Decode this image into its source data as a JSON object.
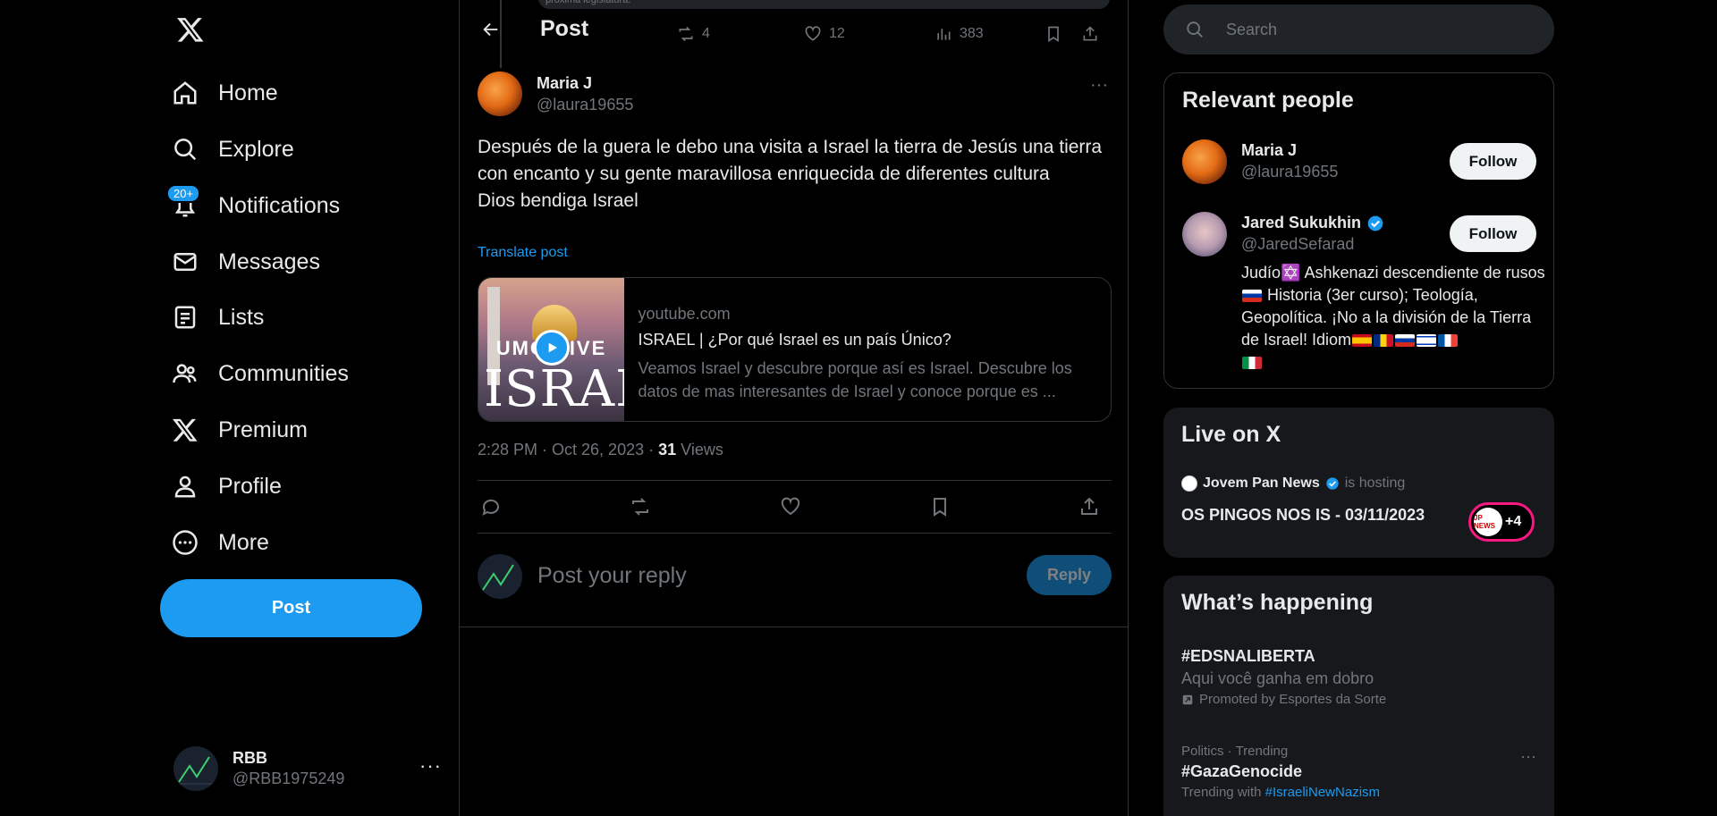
{
  "nav": {
    "items": [
      {
        "label": "Home",
        "icon": "home-icon"
      },
      {
        "label": "Explore",
        "icon": "search-icon"
      },
      {
        "label": "Notifications",
        "icon": "bell-icon"
      },
      {
        "label": "Messages",
        "icon": "mail-icon"
      },
      {
        "label": "Lists",
        "icon": "list-icon"
      },
      {
        "label": "Communities",
        "icon": "people-icon"
      },
      {
        "label": "Premium",
        "icon": "x-logo-icon"
      },
      {
        "label": "Profile",
        "icon": "person-icon"
      },
      {
        "label": "More",
        "icon": "more-circle-icon"
      }
    ],
    "notif_badge": "20+",
    "post_label": "Post",
    "account": {
      "name": "RBB",
      "handle": "@RBB1975249",
      "more": "···"
    }
  },
  "header": {
    "title": "Post"
  },
  "previous": {
    "strip_text": "próxima legislatura.",
    "retweets": "4",
    "likes": "12",
    "views": "383"
  },
  "post": {
    "author_name": "Maria J",
    "author_handle": "@laura19655",
    "more": "···",
    "text": "Después de la guera le debo una visita a Israel la tierra de Jesús una tierra con encanto y su gente maravillosa enriquecida de diferentes cultura\nDios bendiga Israel",
    "translate": "Translate post",
    "card": {
      "domain": "youtube.com",
      "title": "ISRAEL | ¿Por qué Israel es un país Único?",
      "description": "Veamos Israel y descubre porque así es Israel. Descubre los datos de mas interesantes de Israel y conoce porque es ...",
      "thumb_top": "UMO VIVE",
      "thumb_bottom": "ISRAEL"
    },
    "time": "2:28 PM · Oct 26, 2023 · ",
    "views_count": "31",
    "views_label": " Views"
  },
  "reply": {
    "placeholder": "Post your reply",
    "button": "Reply"
  },
  "search": {
    "placeholder": "Search"
  },
  "relevant": {
    "title": "Relevant people",
    "people": [
      {
        "name": "Maria J",
        "handle": "@laura19655",
        "follow": "Follow"
      },
      {
        "name": "Jared Sukukhin",
        "handle": "@JaredSefarad",
        "follow": "Follow",
        "bio_1": "Judío✡️ Ashkenazi descendiente de rusos",
        "bio_2": " Historia (3er curso); Teología, Geopolítica. ¡No a la división de la Tierra de Israel! Idiom"
      }
    ]
  },
  "live": {
    "title": "Live on X",
    "host_name": "Jovem Pan News",
    "host_suffix": "is hosting",
    "space_title": "OS PINGOS NOS IS - 03/11/2023",
    "avatar_text": "JP NEWS",
    "plus": "+4"
  },
  "happening": {
    "title": "What’s happening",
    "t1_title": "#EDSNALIBERTA",
    "t1_sub": "Aqui você ganha em dobro",
    "t1_promo": "Promoted by Esportes da Sorte",
    "t2_ctx": "Politics · Trending",
    "t2_title": "#GazaGenocide",
    "t2_with": "Trending with ",
    "t2_tag": "#IsraeliNewNazism",
    "more": "···"
  },
  "colors": {
    "accent": "#1d9bf0",
    "bg": "#000000",
    "muted": "#71767b",
    "live_ring": "#f91880"
  }
}
